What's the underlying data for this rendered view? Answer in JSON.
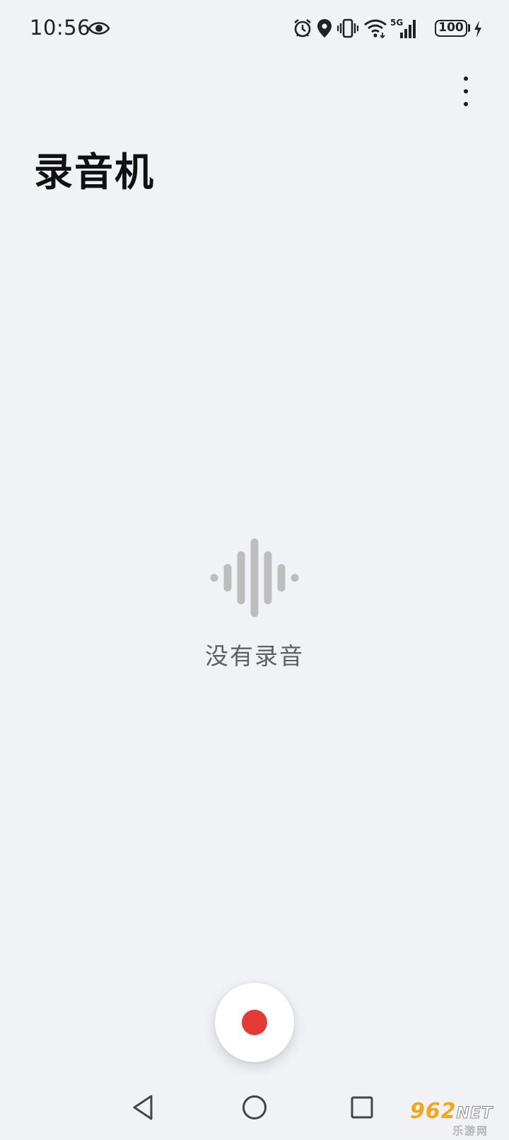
{
  "status_bar": {
    "time": "10:56",
    "battery_level": "100",
    "network": "5G",
    "icons": [
      "eye-icon",
      "alarm-icon",
      "location-icon",
      "vibrate-icon",
      "wifi-icon",
      "signal-icon",
      "battery-icon",
      "charging-icon"
    ]
  },
  "header": {
    "title": "录音机",
    "menu_icon": "more-vertical-icon"
  },
  "empty_state": {
    "icon": "waveform-icon",
    "message": "没有录音"
  },
  "record_button": {
    "icon": "record-dot-icon",
    "accent_color": "#e53935"
  },
  "navigation": {
    "back_icon": "back-triangle-icon",
    "home_icon": "home-circle-icon",
    "recents_icon": "recents-square-icon"
  },
  "watermark": {
    "brand": "962",
    "suffix": "NET",
    "site": "乐游网"
  }
}
